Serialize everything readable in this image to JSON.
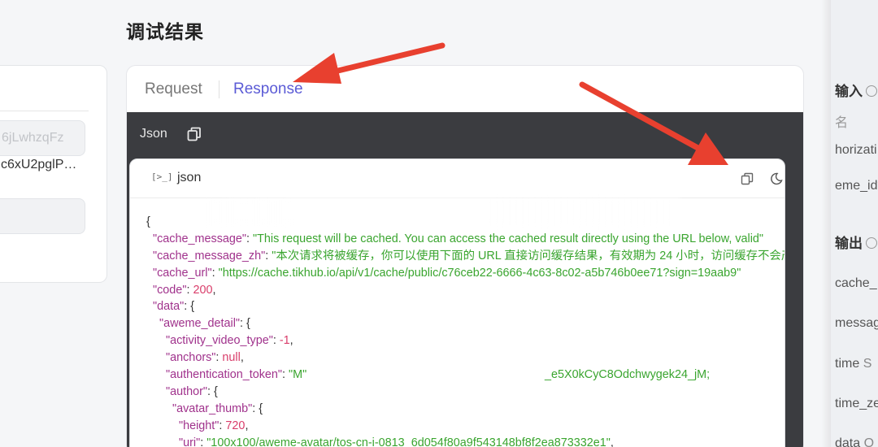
{
  "left": {
    "input1_value": "6jLwhzqFz",
    "text_value": "c6xU2pglP…",
    "input2_value": ""
  },
  "page_title": "调试结果",
  "tabs": {
    "request": "Request",
    "response": "Response"
  },
  "toolbar": {
    "label": "Json",
    "copy_icon": "copy-icon"
  },
  "code_header": {
    "prompt": "[>_]",
    "lang": "json",
    "copy_icon": "copy-icon",
    "theme_icon": "moon-icon"
  },
  "code_lines": [
    "{",
    "  \"cache_message\": \"This request will be cached. You can access the cached result directly using the URL below, valid\"",
    "  \"cache_message_zh\": \"本次请求将被缓存，你可以使用下面的 URL 直接访问缓存结果，有效期为 24 小时，访问缓存不会产\"",
    "  \"cache_url\": \"https://cache.tikhub.io/api/v1/cache/public/c76ceb22-6666-4c63-8c02-a5b746b0ee71?sign=19aab9\"",
    "  \"code\": 200,",
    "  \"data\": {",
    "    \"aweme_detail\": {",
    "      \"activity_video_type\": -1,",
    "      \"anchors\": null,",
    "      \"authentication_token\": \"M\"",
    "      \"author\": {",
    "        \"avatar_thumb\": {",
    "          \"height\": 720,",
    "          \"uri\": \"100x100/aweme-avatar/tos-cn-i-0813_6d054f80a9f543148bf8f2ea873332e1\","
  ],
  "auth_token_tail": "_e5X0kCyC8Odchwygek24_jM;",
  "right_panel": {
    "input_heading": "输入",
    "name_label": "名",
    "param1": "horizati",
    "param2": "eme_id",
    "param2_required": "*",
    "output_heading": "输出",
    "out1": "cache_",
    "out2": "messag",
    "out3": "time",
    "out3_type": "S",
    "out4": "time_ze",
    "out5": "data",
    "out5_type": "O"
  },
  "colors": {
    "accent": "#5b5bd6",
    "arrow": "#e8402f",
    "key": "#a0328c",
    "string": "#3aa52f",
    "number": "#d93d6a",
    "dark_bar": "#3b3c40"
  }
}
